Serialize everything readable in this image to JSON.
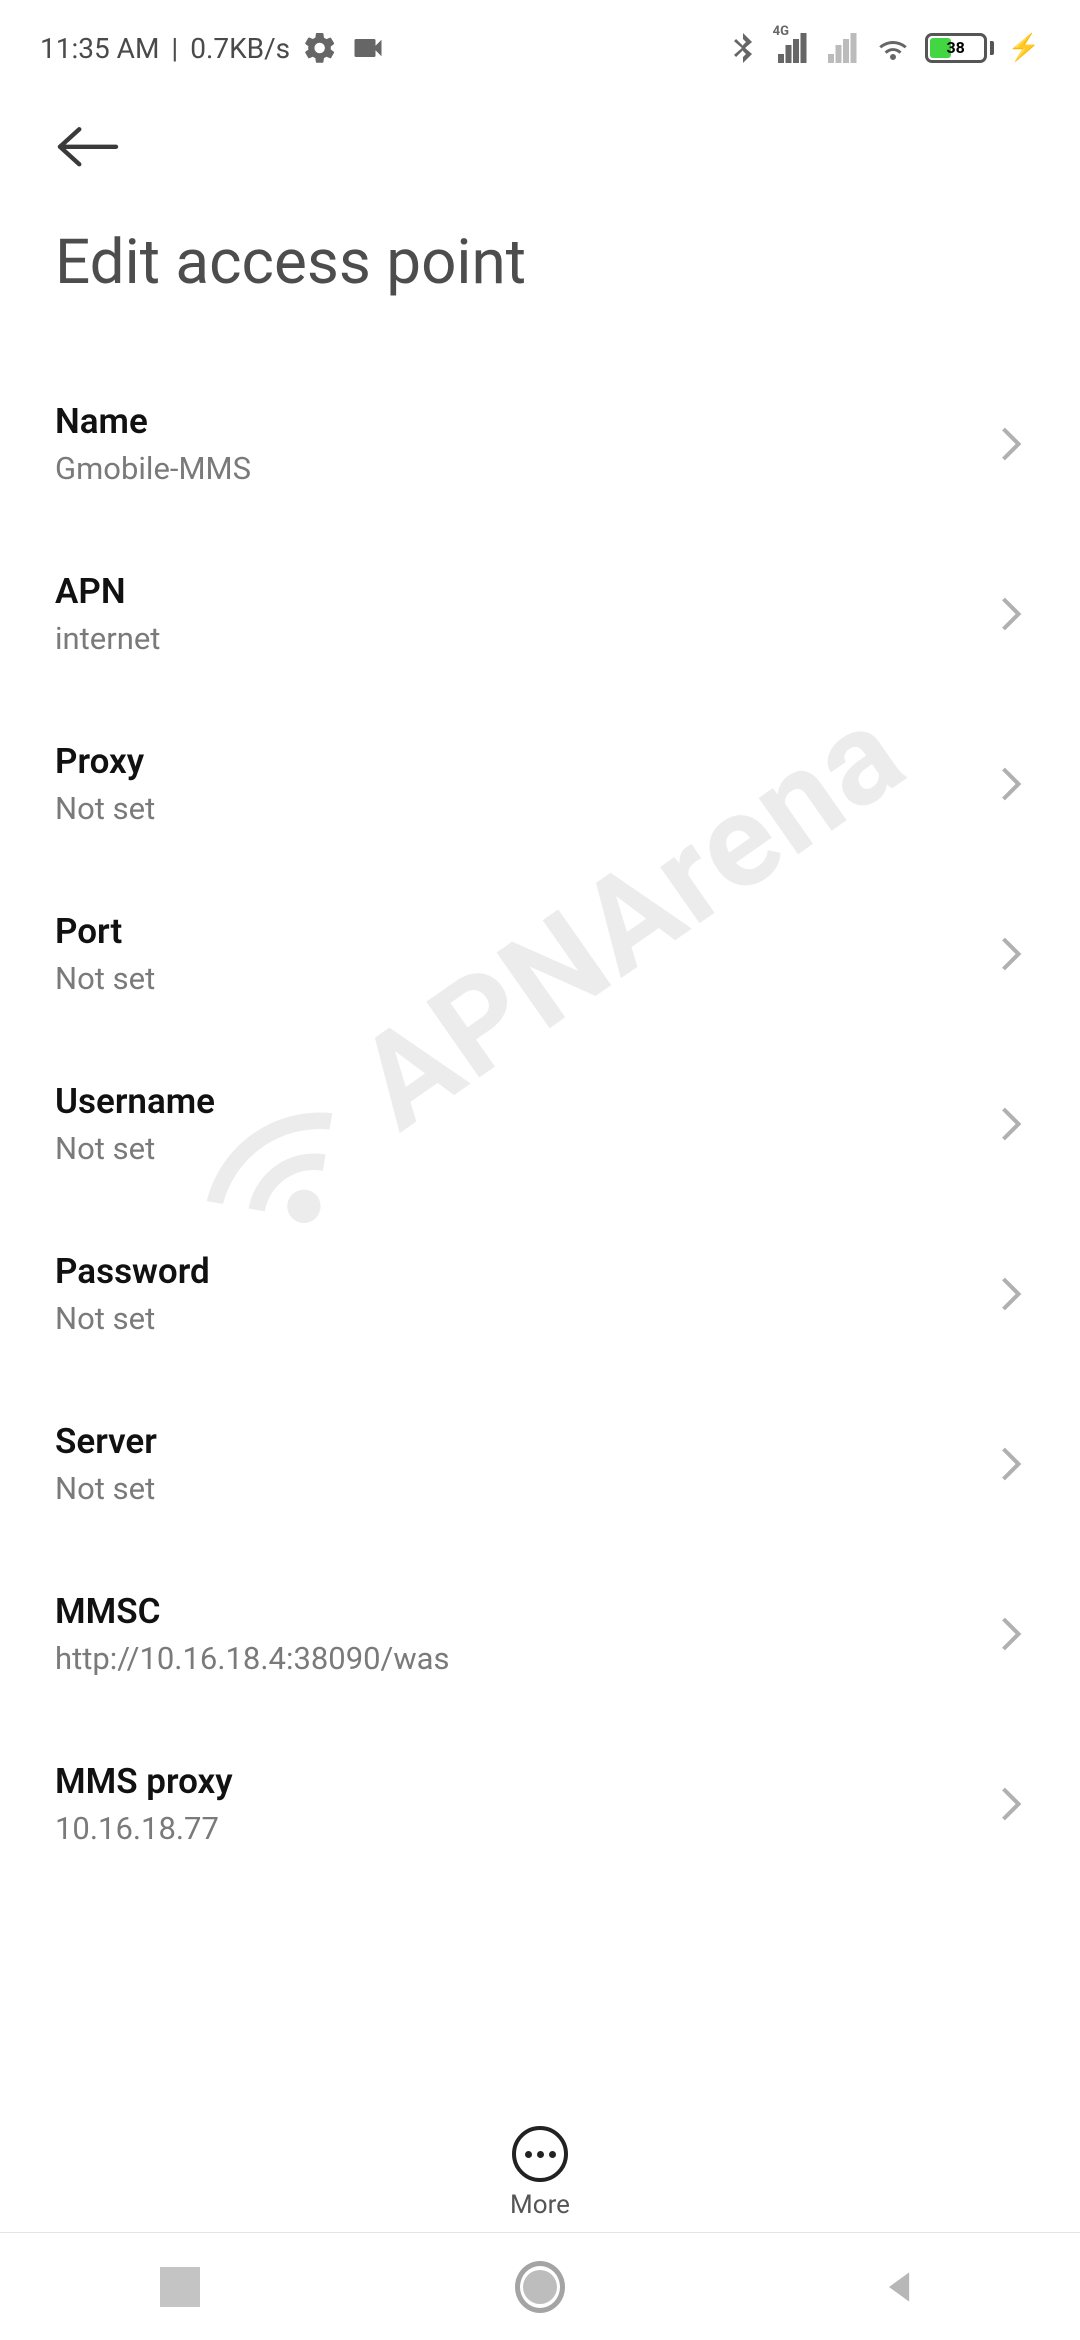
{
  "status": {
    "time": "11:35 AM",
    "speed": "0.7KB/s",
    "battery_pct": "38",
    "net_badge": "4G"
  },
  "header": {
    "title": "Edit access point"
  },
  "items": [
    {
      "label": "Name",
      "value": "Gmobile-MMS"
    },
    {
      "label": "APN",
      "value": "internet"
    },
    {
      "label": "Proxy",
      "value": "Not set"
    },
    {
      "label": "Port",
      "value": "Not set"
    },
    {
      "label": "Username",
      "value": "Not set"
    },
    {
      "label": "Password",
      "value": "Not set"
    },
    {
      "label": "Server",
      "value": "Not set"
    },
    {
      "label": "MMSC",
      "value": "http://10.16.18.4:38090/was"
    },
    {
      "label": "MMS proxy",
      "value": "10.16.18.77"
    }
  ],
  "more_label": "More",
  "watermark": "APNArena"
}
